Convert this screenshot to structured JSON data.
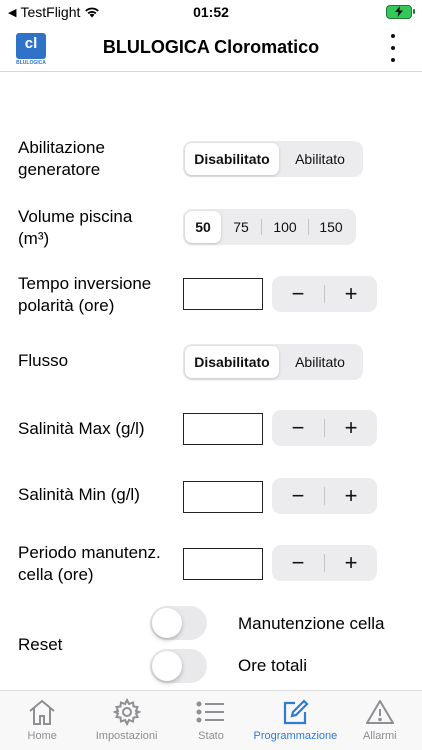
{
  "status_bar": {
    "carrier": "TestFlight",
    "time": "01:52"
  },
  "header": {
    "logo_text": "cl",
    "logo_sub": "BLULOGICA",
    "title": "BLULOGICA Cloromatico"
  },
  "form": {
    "generator": {
      "label": "Abilitazione generatore",
      "options": [
        "Disabilitato",
        "Abilitato"
      ],
      "selected": "Disabilitato"
    },
    "pool_volume": {
      "label": "Volume piscina (m³)",
      "options": [
        "50",
        "75",
        "100",
        "150"
      ],
      "selected": "50"
    },
    "polarity_time": {
      "label": "Tempo inversione polarità (ore)",
      "value": "",
      "minus": "−",
      "plus": "+"
    },
    "flow": {
      "label": "Flusso",
      "options": [
        "Disabilitato",
        "Abilitato"
      ],
      "selected": "Disabilitato"
    },
    "salinity_max": {
      "label": "Salinità Max (g/l)",
      "value": "",
      "minus": "−",
      "plus": "+"
    },
    "salinity_min": {
      "label": "Salinità Min (g/l)",
      "value": "",
      "minus": "−",
      "plus": "+"
    },
    "maintenance_period": {
      "label": "Periodo manutenz. cella (ore)",
      "value": "",
      "minus": "−",
      "plus": "+"
    },
    "reset": {
      "label": "Reset",
      "toggles": [
        {
          "label": "Manutenzione cella",
          "on": false
        },
        {
          "label": "Ore totali",
          "on": false
        }
      ]
    }
  },
  "tabs": [
    {
      "label": "Home",
      "icon": "home-icon",
      "active": false
    },
    {
      "label": "Impostazioni",
      "icon": "gear-icon",
      "active": false
    },
    {
      "label": "Stato",
      "icon": "list-icon",
      "active": false
    },
    {
      "label": "Programmazione",
      "icon": "edit-icon",
      "active": true
    },
    {
      "label": "Allarmi",
      "icon": "warning-icon",
      "active": false
    }
  ],
  "colors": {
    "accent": "#2f7bd6",
    "inactive_tab": "#8e8e93",
    "battery": "#34c759"
  }
}
